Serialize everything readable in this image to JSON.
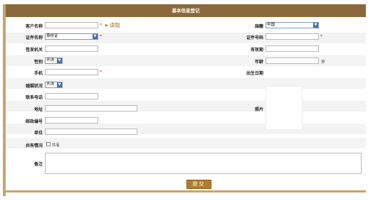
{
  "header": {
    "title": "基本信息登记"
  },
  "labels": {
    "customer_name": "客户名称",
    "country": "国籍",
    "id_type": "证件名称",
    "id_number": "证件号码",
    "issuing_authority": "签发机关",
    "validity": "有效期",
    "gender": "性别",
    "age": "年龄",
    "mobile": "手机",
    "birth_date": "出生日期",
    "marital_status": "婚姻状况",
    "phone": "联系电话",
    "photo": "照片",
    "address": "地址",
    "postal_code": "邮政编号",
    "employer": "单位",
    "shared": "共有情况",
    "remarks": "备注"
  },
  "values": {
    "customer_name": "",
    "country": "中国",
    "id_type": "身份证",
    "id_number": "",
    "issuing_authority": "",
    "validity": "",
    "gender": "不详",
    "age": "",
    "age_unit": "岁",
    "mobile": "",
    "marital_status": "不详",
    "phone": "",
    "address": "",
    "postal_code": "",
    "employer": "",
    "remarks": ""
  },
  "read_card_label": "读取",
  "shared_checkbox_label": "共有",
  "required_mark": "*",
  "submit_label": "提交",
  "colors": {
    "header": "#8a6a3a",
    "border": "#c8a56a",
    "button": "#b07d2e",
    "required": "#d22222"
  }
}
